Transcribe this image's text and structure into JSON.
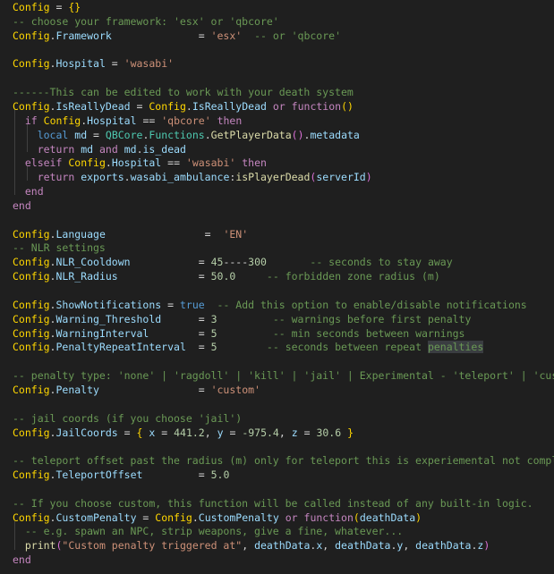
{
  "code_lines": [
    [
      [
        "cfg",
        "Config"
      ],
      [
        "op",
        " = "
      ],
      [
        "br",
        "{}"
      ]
    ],
    [
      [
        "cmt",
        "-- choose your framework: 'esx' or 'qbcore'"
      ]
    ],
    [
      [
        "cfg",
        "Config"
      ],
      [
        "op",
        "."
      ],
      [
        "var",
        "Framework"
      ],
      [
        "op",
        "              = "
      ],
      [
        "str",
        "'esx'"
      ],
      [
        "op",
        "  "
      ],
      [
        "cmt",
        "-- or 'qbcore'"
      ]
    ],
    [],
    [
      [
        "cfg",
        "Config"
      ],
      [
        "op",
        "."
      ],
      [
        "var",
        "Hospital"
      ],
      [
        "op",
        " = "
      ],
      [
        "str",
        "'wasabi'"
      ]
    ],
    [],
    [
      [
        "cmt",
        "------This can be edited to work with your death system"
      ]
    ],
    [
      [
        "cfg",
        "Config"
      ],
      [
        "op",
        "."
      ],
      [
        "var",
        "IsReallyDead"
      ],
      [
        "op",
        " = "
      ],
      [
        "cfg",
        "Config"
      ],
      [
        "op",
        "."
      ],
      [
        "var",
        "IsReallyDead"
      ],
      [
        "op",
        " "
      ],
      [
        "kw",
        "or"
      ],
      [
        "op",
        " "
      ],
      [
        "kw",
        "function"
      ],
      [
        "br",
        "()"
      ]
    ],
    [
      [
        "op",
        "  "
      ],
      [
        "kw",
        "if"
      ],
      [
        "op",
        " "
      ],
      [
        "cfg",
        "Config"
      ],
      [
        "op",
        "."
      ],
      [
        "var",
        "Hospital"
      ],
      [
        "op",
        " == "
      ],
      [
        "str",
        "'qbcore'"
      ],
      [
        "op",
        " "
      ],
      [
        "kw",
        "then"
      ]
    ],
    [
      [
        "op",
        "    "
      ],
      [
        "bool",
        "local"
      ],
      [
        "op",
        " "
      ],
      [
        "var",
        "md"
      ],
      [
        "op",
        " = "
      ],
      [
        "ty",
        "QBCore"
      ],
      [
        "op",
        "."
      ],
      [
        "ty",
        "Functions"
      ],
      [
        "op",
        "."
      ],
      [
        "fn",
        "GetPlayerData"
      ],
      [
        "br2",
        "()"
      ],
      [
        "op",
        "."
      ],
      [
        "var",
        "metadata"
      ]
    ],
    [
      [
        "op",
        "    "
      ],
      [
        "kw",
        "return"
      ],
      [
        "op",
        " "
      ],
      [
        "var",
        "md"
      ],
      [
        "op",
        " "
      ],
      [
        "kw",
        "and"
      ],
      [
        "op",
        " "
      ],
      [
        "var",
        "md"
      ],
      [
        "op",
        "."
      ],
      [
        "var",
        "is_dead"
      ]
    ],
    [
      [
        "op",
        "  "
      ],
      [
        "kw",
        "elseif"
      ],
      [
        "op",
        " "
      ],
      [
        "cfg",
        "Config"
      ],
      [
        "op",
        "."
      ],
      [
        "var",
        "Hospital"
      ],
      [
        "op",
        " == "
      ],
      [
        "str",
        "'wasabi'"
      ],
      [
        "op",
        " "
      ],
      [
        "kw",
        "then"
      ]
    ],
    [
      [
        "op",
        "    "
      ],
      [
        "kw",
        "return"
      ],
      [
        "op",
        " "
      ],
      [
        "var",
        "exports"
      ],
      [
        "op",
        "."
      ],
      [
        "var",
        "wasabi_ambulance"
      ],
      [
        "op",
        ":"
      ],
      [
        "fn",
        "isPlayerDead"
      ],
      [
        "br2",
        "("
      ],
      [
        "var",
        "serverId"
      ],
      [
        "br2",
        ")"
      ]
    ],
    [
      [
        "op",
        "  "
      ],
      [
        "kw",
        "end"
      ]
    ],
    [
      [
        "kw",
        "end"
      ]
    ],
    [],
    [
      [
        "cfg",
        "Config"
      ],
      [
        "op",
        "."
      ],
      [
        "var",
        "Language"
      ],
      [
        "op",
        "                =  "
      ],
      [
        "str",
        "'EN'"
      ]
    ],
    [
      [
        "cmt",
        "-- NLR settings"
      ]
    ],
    [
      [
        "cfg",
        "Config"
      ],
      [
        "op",
        "."
      ],
      [
        "var",
        "NLR_Cooldown"
      ],
      [
        "op",
        "           = "
      ],
      [
        "num",
        "45"
      ],
      [
        "op",
        "----"
      ],
      [
        "num",
        "300"
      ],
      [
        "op",
        "       "
      ],
      [
        "cmt",
        "-- seconds to stay away"
      ]
    ],
    [
      [
        "cfg",
        "Config"
      ],
      [
        "op",
        "."
      ],
      [
        "var",
        "NLR_Radius"
      ],
      [
        "op",
        "             = "
      ],
      [
        "num",
        "50.0"
      ],
      [
        "op",
        "     "
      ],
      [
        "cmt",
        "-- forbidden zone radius (m)"
      ]
    ],
    [],
    [
      [
        "cfg",
        "Config"
      ],
      [
        "op",
        "."
      ],
      [
        "var",
        "ShowNotifications"
      ],
      [
        "op",
        " = "
      ],
      [
        "bool",
        "true"
      ],
      [
        "op",
        "  "
      ],
      [
        "cmt",
        "-- Add this option to enable/disable notifications"
      ]
    ],
    [
      [
        "cfg",
        "Config"
      ],
      [
        "op",
        "."
      ],
      [
        "var",
        "Warning_Threshold"
      ],
      [
        "op",
        "      = "
      ],
      [
        "num",
        "3"
      ],
      [
        "op",
        "         "
      ],
      [
        "cmt",
        "-- warnings before first penalty"
      ]
    ],
    [
      [
        "cfg",
        "Config"
      ],
      [
        "op",
        "."
      ],
      [
        "var",
        "WarningInterval"
      ],
      [
        "op",
        "        = "
      ],
      [
        "num",
        "5"
      ],
      [
        "op",
        "         "
      ],
      [
        "cmt",
        "-- min seconds between warnings"
      ]
    ],
    [
      [
        "cfg",
        "Config"
      ],
      [
        "op",
        "."
      ],
      [
        "var",
        "PenaltyRepeatInterval"
      ],
      [
        "op",
        "  = "
      ],
      [
        "num",
        "5"
      ],
      [
        "op",
        "        "
      ],
      [
        "cmt",
        "-- seconds between repeat "
      ],
      [
        "hl",
        "penalties"
      ]
    ],
    [],
    [
      [
        "cmt",
        "-- penalty type: 'none' | 'ragdoll' | 'kill' | 'jail' | Experimental - 'teleport' | 'custom'"
      ]
    ],
    [
      [
        "cfg",
        "Config"
      ],
      [
        "op",
        "."
      ],
      [
        "var",
        "Penalty"
      ],
      [
        "op",
        "                = "
      ],
      [
        "str",
        "'custom'"
      ]
    ],
    [],
    [
      [
        "cmt",
        "-- jail coords (if you choose 'jail')"
      ]
    ],
    [
      [
        "cfg",
        "Config"
      ],
      [
        "op",
        "."
      ],
      [
        "var",
        "JailCoords"
      ],
      [
        "op",
        " = "
      ],
      [
        "br",
        "{"
      ],
      [
        "op",
        " "
      ],
      [
        "var",
        "x"
      ],
      [
        "op",
        " = "
      ],
      [
        "num",
        "441.2"
      ],
      [
        "op",
        ", "
      ],
      [
        "var",
        "y"
      ],
      [
        "op",
        " = "
      ],
      [
        "num",
        "-975.4"
      ],
      [
        "op",
        ", "
      ],
      [
        "var",
        "z"
      ],
      [
        "op",
        " = "
      ],
      [
        "num",
        "30.6"
      ],
      [
        "op",
        " "
      ],
      [
        "br",
        "}"
      ]
    ],
    [],
    [
      [
        "cmt",
        "-- teleport offset past the radius (m) only for teleport this is experiemental not complete"
      ]
    ],
    [
      [
        "cfg",
        "Config"
      ],
      [
        "op",
        "."
      ],
      [
        "var",
        "TeleportOffset"
      ],
      [
        "op",
        "         = "
      ],
      [
        "num",
        "5.0"
      ]
    ],
    [],
    [
      [
        "cmt",
        "-- If you choose custom, this function will be called instead of any built-in logic."
      ]
    ],
    [
      [
        "cfg",
        "Config"
      ],
      [
        "op",
        "."
      ],
      [
        "var",
        "CustomPenalty"
      ],
      [
        "op",
        " = "
      ],
      [
        "cfg",
        "Config"
      ],
      [
        "op",
        "."
      ],
      [
        "var",
        "CustomPenalty"
      ],
      [
        "op",
        " "
      ],
      [
        "kw",
        "or"
      ],
      [
        "op",
        " "
      ],
      [
        "kw",
        "function"
      ],
      [
        "br",
        "("
      ],
      [
        "var",
        "deathData"
      ],
      [
        "br",
        ")"
      ]
    ],
    [
      [
        "op",
        "  "
      ],
      [
        "cmt",
        "-- e.g. spawn an NPC, strip weapons, give a fine, whatever..."
      ]
    ],
    [
      [
        "op",
        "  "
      ],
      [
        "fn",
        "print"
      ],
      [
        "br2",
        "("
      ],
      [
        "str",
        "\"Custom penalty triggered at\""
      ],
      [
        "op",
        ", "
      ],
      [
        "var",
        "deathData"
      ],
      [
        "op",
        "."
      ],
      [
        "var",
        "x"
      ],
      [
        "op",
        ", "
      ],
      [
        "var",
        "deathData"
      ],
      [
        "op",
        "."
      ],
      [
        "var",
        "y"
      ],
      [
        "op",
        ", "
      ],
      [
        "var",
        "deathData"
      ],
      [
        "op",
        "."
      ],
      [
        "var",
        "z"
      ],
      [
        "br2",
        ")"
      ]
    ],
    [
      [
        "kw",
        "end"
      ]
    ]
  ]
}
